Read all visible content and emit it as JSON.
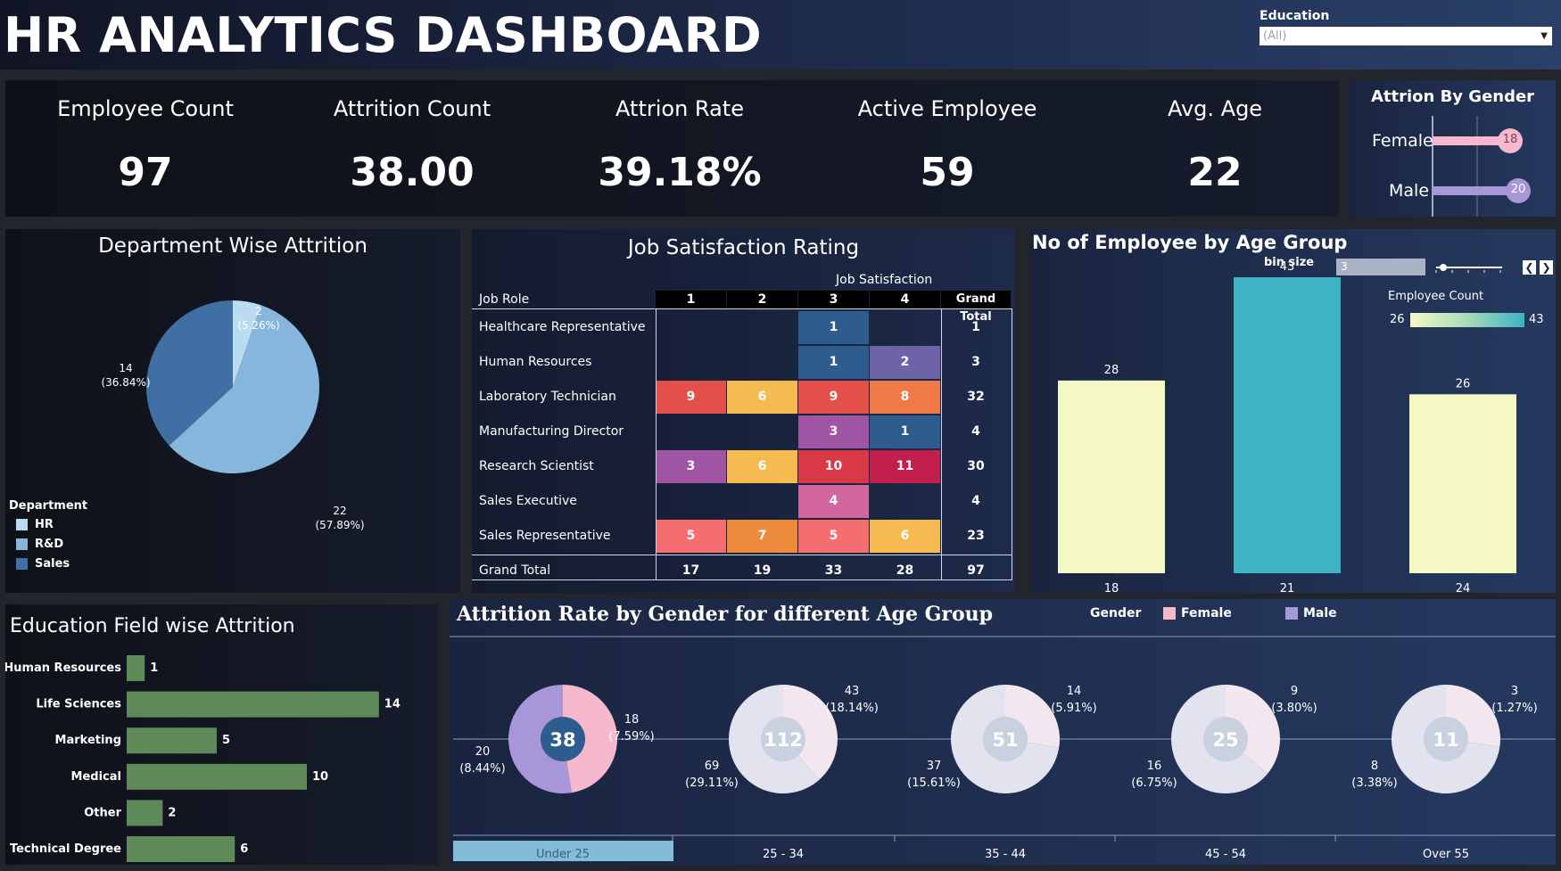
{
  "header": {
    "title": "HR ANALYTICS DASHBOARD",
    "education_filter_label": "Education",
    "education_filter_value": "(All)"
  },
  "kpis": [
    {
      "label": "Employee Count",
      "value": "97"
    },
    {
      "label": "Attrition Count",
      "value": "38.00"
    },
    {
      "label": "Attrion Rate",
      "value": "39.18%"
    },
    {
      "label": "Active Employee",
      "value": "59"
    },
    {
      "label": "Avg. Age",
      "value": "22"
    }
  ],
  "gender_panel": {
    "title": "Attrion By Gender",
    "female_label": "Female",
    "female_value": "18",
    "male_label": "Male",
    "male_value": "20"
  },
  "department": {
    "title": "Department Wise Attrition",
    "legend_title": "Department",
    "legend": [
      "HR",
      "R&D",
      "Sales"
    ],
    "labels": {
      "hr": [
        "2",
        "(5.26%)"
      ],
      "rd": [
        "22",
        "(57.89%)"
      ],
      "sales": [
        "14",
        "(36.84%)"
      ]
    }
  },
  "job_satisfaction": {
    "title": "Job Satisfaction Rating",
    "column_group": "Job Satisfaction",
    "row_header": "Job Role",
    "columns": [
      "1",
      "2",
      "3",
      "4",
      "Grand Total"
    ],
    "rows": [
      {
        "role": "Healthcare Representative",
        "v": [
          "",
          "",
          "1",
          ""
        ],
        "total": "1"
      },
      {
        "role": "Human Resources",
        "v": [
          "",
          "",
          "1",
          "2"
        ],
        "total": "3"
      },
      {
        "role": "Laboratory Technician",
        "v": [
          "9",
          "6",
          "9",
          "8"
        ],
        "total": "32"
      },
      {
        "role": "Manufacturing Director",
        "v": [
          "",
          "",
          "3",
          "1"
        ],
        "total": "4"
      },
      {
        "role": "Research Scientist",
        "v": [
          "3",
          "6",
          "10",
          "11"
        ],
        "total": "30"
      },
      {
        "role": "Sales Executive",
        "v": [
          "",
          "",
          "4",
          ""
        ],
        "total": "4"
      },
      {
        "role": "Sales Representative",
        "v": [
          "5",
          "7",
          "5",
          "6"
        ],
        "total": "23"
      }
    ],
    "grand_total": {
      "label": "Grand Total",
      "v": [
        "17",
        "19",
        "33",
        "28"
      ],
      "total": "97"
    }
  },
  "age_group": {
    "title": "No of Employee by Age Group",
    "bin_label": "bin size",
    "bin_value": "3",
    "legend_title": "Employee Count",
    "legend_min": "26",
    "legend_max": "43",
    "prev_icon": "chevron-left-icon",
    "next_icon": "chevron-right-icon"
  },
  "education_field": {
    "title": "Education Field wise Attrition",
    "bar_color": "#5e8a57"
  },
  "attrition_age": {
    "title": "Attrition Rate by Gender for different Age Group",
    "legend_title": "Gender",
    "legend_female": "Female",
    "legend_male": "Male",
    "groups": [
      {
        "label": "Under 25",
        "total": "38",
        "male": "20",
        "male_pct": "(8.44%)",
        "female": "18",
        "female_pct": "(7.59%)",
        "male_fraction": 0.526
      },
      {
        "label": "25 - 34",
        "total": "112",
        "male": "69",
        "male_pct": "(29.11%)",
        "female": "43",
        "female_pct": "(18.14%)",
        "male_fraction": 0.616
      },
      {
        "label": "35 - 44",
        "total": "51",
        "male": "37",
        "male_pct": "(15.61%)",
        "female": "14",
        "female_pct": "(5.91%)",
        "male_fraction": 0.725
      },
      {
        "label": "45 - 54",
        "total": "25",
        "male": "16",
        "male_pct": "(6.75%)",
        "female": "9",
        "female_pct": "(3.80%)",
        "male_fraction": 0.64
      },
      {
        "label": "Over 55",
        "total": "11",
        "male": "8",
        "male_pct": "(3.38%)",
        "female": "3",
        "female_pct": "(1.27%)",
        "male_fraction": 0.727
      }
    ]
  },
  "chart_data": [
    {
      "type": "pie",
      "title": "Department Wise Attrition",
      "categories": [
        "HR",
        "R&D",
        "Sales"
      ],
      "values": [
        2,
        22,
        14
      ],
      "percentages": [
        5.26,
        57.89,
        36.84
      ],
      "colors": [
        "#b9dcf0",
        "#86b6dc",
        "#3f6fa3"
      ]
    },
    {
      "type": "bar",
      "title": "No of Employee by Age Group",
      "categories": [
        "18",
        "21",
        "24"
      ],
      "values": [
        28,
        43,
        26
      ],
      "ylim": [
        0,
        43
      ],
      "colors": [
        "#f4f9c4",
        "#3db3c3",
        "#f4f9c4"
      ]
    },
    {
      "type": "bar",
      "orientation": "horizontal",
      "title": "Education Field wise Attrition",
      "categories": [
        "Human Resources",
        "Life Sciences",
        "Marketing",
        "Medical",
        "Other",
        "Technical Degree"
      ],
      "values": [
        1,
        14,
        5,
        10,
        2,
        6
      ]
    },
    {
      "type": "bar",
      "orientation": "horizontal",
      "title": "Attrion By Gender",
      "categories": [
        "Female",
        "Male"
      ],
      "values": [
        18,
        20
      ],
      "colors": [
        "#f5b8cc",
        "#a797d8"
      ]
    },
    {
      "type": "heatmap",
      "title": "Job Satisfaction Rating",
      "x": [
        "1",
        "2",
        "3",
        "4"
      ],
      "y": [
        "Healthcare Representative",
        "Human Resources",
        "Laboratory Technician",
        "Manufacturing Director",
        "Research Scientist",
        "Sales Executive",
        "Sales Representative"
      ],
      "values": [
        [
          null,
          null,
          1,
          null
        ],
        [
          null,
          null,
          1,
          2
        ],
        [
          9,
          6,
          9,
          8
        ],
        [
          null,
          null,
          3,
          1
        ],
        [
          3,
          6,
          10,
          11
        ],
        [
          null,
          null,
          4,
          null
        ],
        [
          5,
          7,
          5,
          6
        ]
      ]
    },
    {
      "type": "pie",
      "title": "Attrition Rate by Gender for different Age Group",
      "categories": [
        "Under 25",
        "25 - 34",
        "35 - 44",
        "45 - 54",
        "Over 55"
      ],
      "series": [
        {
          "name": "Male",
          "values": [
            20,
            69,
            37,
            16,
            8
          ]
        },
        {
          "name": "Female",
          "values": [
            18,
            43,
            14,
            9,
            3
          ]
        }
      ],
      "totals": [
        38,
        112,
        51,
        25,
        11
      ]
    }
  ]
}
